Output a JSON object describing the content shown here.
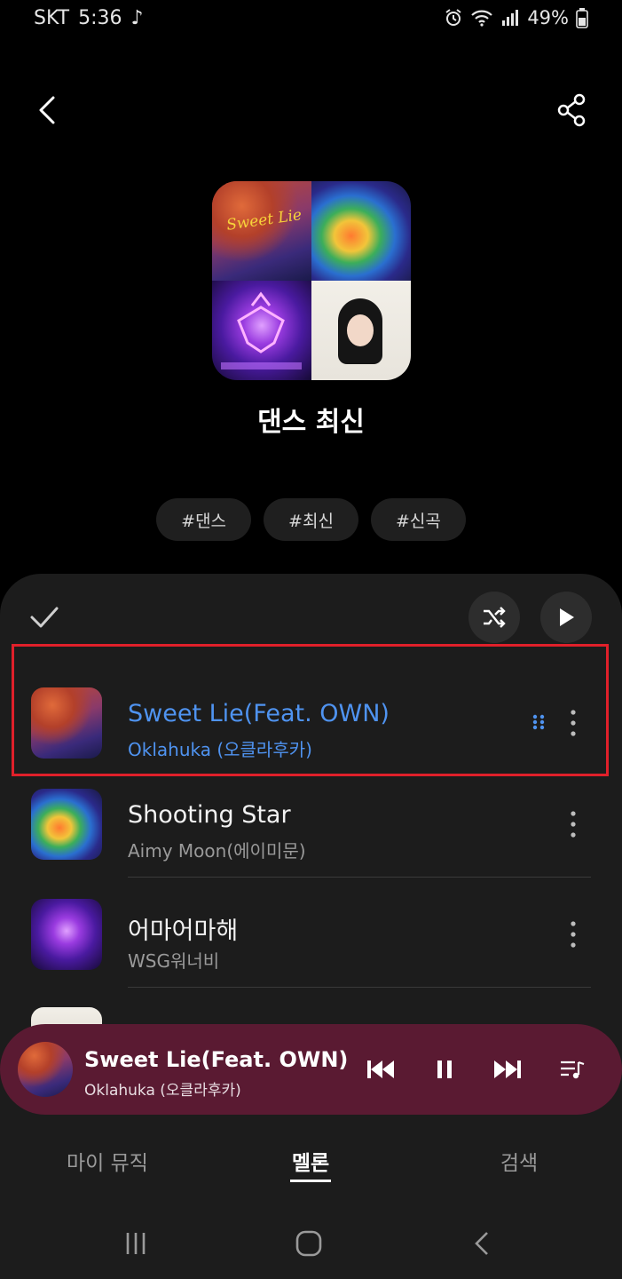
{
  "status_bar": {
    "carrier": "SKT",
    "time": "5:36",
    "battery": "49%"
  },
  "header": {
    "back_icon": "chevron-left-icon",
    "share_icon": "share-icon"
  },
  "playlist": {
    "title": "댄스 최신",
    "cover_texts": {
      "art1_title": "Sweet Lie"
    },
    "tags": [
      "#댄스",
      "#최신",
      "#신곡"
    ]
  },
  "track_list": {
    "tracks": [
      {
        "title": "Sweet Lie(Feat. OWN)",
        "artist": "Oklahuka (오클라후카)",
        "active": true
      },
      {
        "title": "Shooting Star",
        "artist": "Aimy Moon(에이미문)",
        "active": false
      },
      {
        "title": "어마어마해",
        "artist": "WSG워너비",
        "active": false
      }
    ]
  },
  "mini_player": {
    "title": "Sweet Lie(Feat. OWN)",
    "artist": "Oklahuka (오클라후카)",
    "background": "#5a1a32"
  },
  "bottom_tabs": [
    {
      "label": "마이 뮤직",
      "active": false
    },
    {
      "label": "멜론",
      "active": true
    },
    {
      "label": "검색",
      "active": false
    }
  ],
  "colors": {
    "accent_blue": "#4f93f0",
    "highlight_red": "#e0202a"
  }
}
